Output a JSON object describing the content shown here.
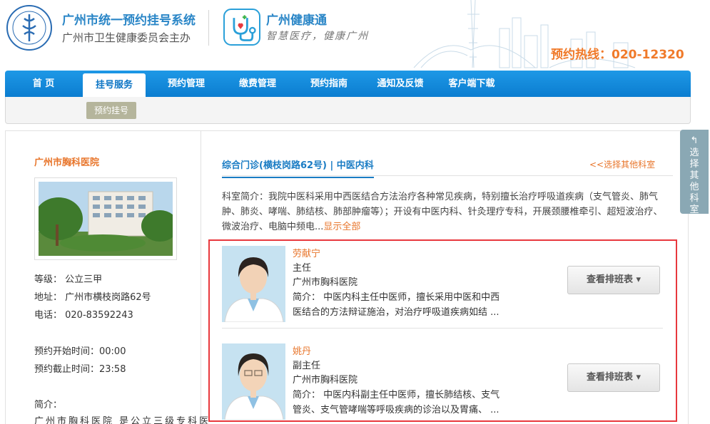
{
  "header": {
    "site_title": "广州市统一预约挂号系统",
    "site_subtitle": "广州市卫生健康委员会主办",
    "app_title": "广州健康通",
    "app_slogan": "智慧医疗，健康广州",
    "hotline": "预约热线：020-12320"
  },
  "nav": {
    "items": [
      "首 页",
      "挂号服务",
      "预约管理",
      "缴费管理",
      "预约指南",
      "通知及反馈",
      "客户端下载"
    ],
    "active_index": 1,
    "sub_item": "预约挂号"
  },
  "hospital": {
    "name": "广州市胸科医院",
    "level": "等级：  公立三甲",
    "address": "地址：  广州市横枝岗路62号",
    "phone": "电话：  020-83592243",
    "open_time": "预约开始时间：00:00",
    "close_time": "预约截止时间：23:58",
    "intro_label": "简介：",
    "intro_text": "广州市胸科医院 是公立三级专科医"
  },
  "department": {
    "title": "综合门诊(横枝岗路62号) | 中医内科",
    "other_link": "<<选择其他科室",
    "description": "科室简介：我院中医科采用中西医结合方法治疗各种常见疾病，特别擅长治疗呼吸道疾病（支气管炎、肺气肿、肺炎、哮喘、肺结核、肺部肿瘤等）；开设有中医内科、针灸理疗专科，开展颈腰椎牵引、超短波治疗、微波治疗、电脑中频电...",
    "show_all": "显示全部"
  },
  "doctors": [
    {
      "name": "劳献宁",
      "title": "主任",
      "hospital": "广州市胸科医院",
      "intro_line1": "简介：  中医内科主任中医师，擅长采用中医和中西",
      "intro_line2": "医结合的方法辩证施治，对治疗呼吸道疾病如结  ...",
      "button": "查看排班表"
    },
    {
      "name": "姚丹",
      "title": "副主任",
      "hospital": "广州市胸科医院",
      "intro_line1": "简介：  中医内科副主任中医师，擅长肺结核、支气",
      "intro_line2": "管炎、支气管哮喘等呼吸疾病的诊治以及胃痛、  ...",
      "button": "查看排班表"
    }
  ],
  "side_tab": {
    "label": "选择其他科室"
  },
  "colors": {
    "nav_blue": "#0b7dd0",
    "accent_orange": "#e8762c",
    "link_blue": "#1a7cc4",
    "highlight_red": "#e8383d"
  }
}
